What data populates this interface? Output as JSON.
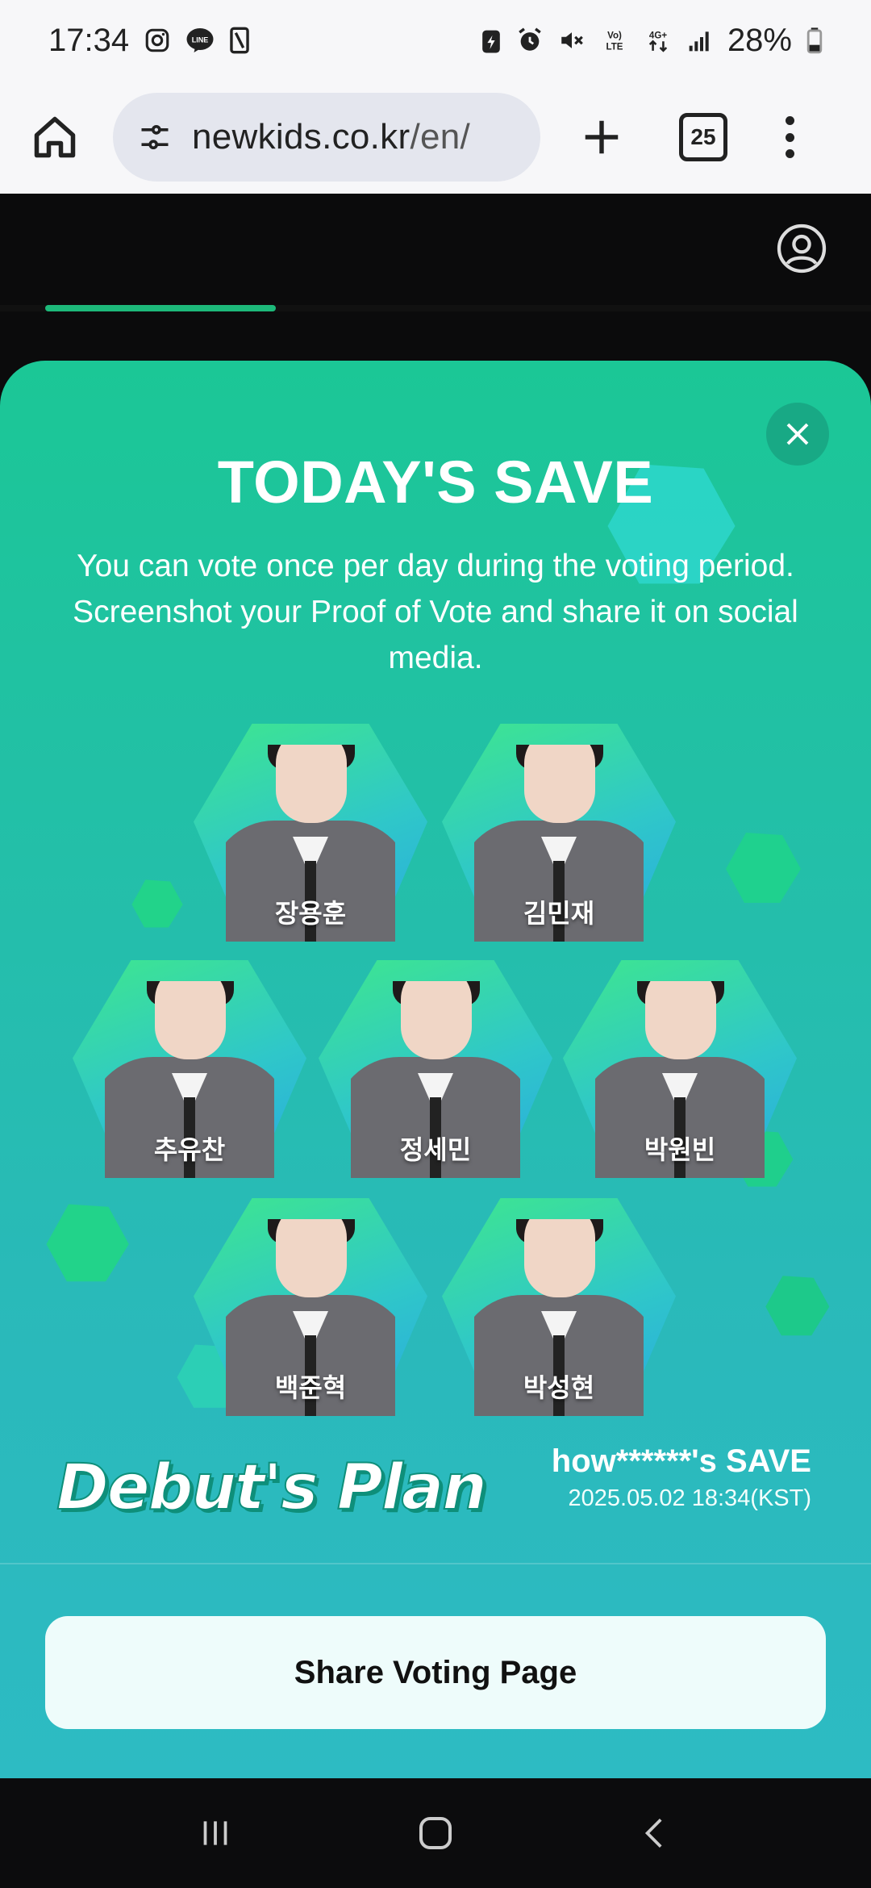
{
  "status_bar": {
    "time": "17:34",
    "battery": "28%",
    "left_icons": [
      "instagram-icon",
      "line-icon",
      "screen-icon"
    ],
    "right_icons": [
      "battery-saver-icon",
      "alarm-icon",
      "mute-icon",
      "volte-icon",
      "4g-icon",
      "signal-icon",
      "battery-icon"
    ]
  },
  "browser": {
    "url_host": "newkids.co.kr",
    "url_path": "/en/",
    "tab_count": "25"
  },
  "modal": {
    "title": "TODAY'S SAVE",
    "description": "You can vote once per day during the voting period. Screenshot your Proof of Vote and share it on social media.",
    "members": [
      {
        "name": "장용훈"
      },
      {
        "name": "김민재"
      },
      {
        "name": "추유찬"
      },
      {
        "name": "정세민"
      },
      {
        "name": "박원빈"
      },
      {
        "name": "백준혁"
      },
      {
        "name": "박성현"
      }
    ],
    "logo_text": "Debut's Plan",
    "save_name": "how******'s SAVE",
    "save_time": "2025.05.02 18:34(KST)",
    "share_label": "Share Voting Page"
  },
  "colors": {
    "accent": "#1db97a",
    "modal_top": "#1bc796",
    "modal_bottom": "#2dbbc3"
  }
}
